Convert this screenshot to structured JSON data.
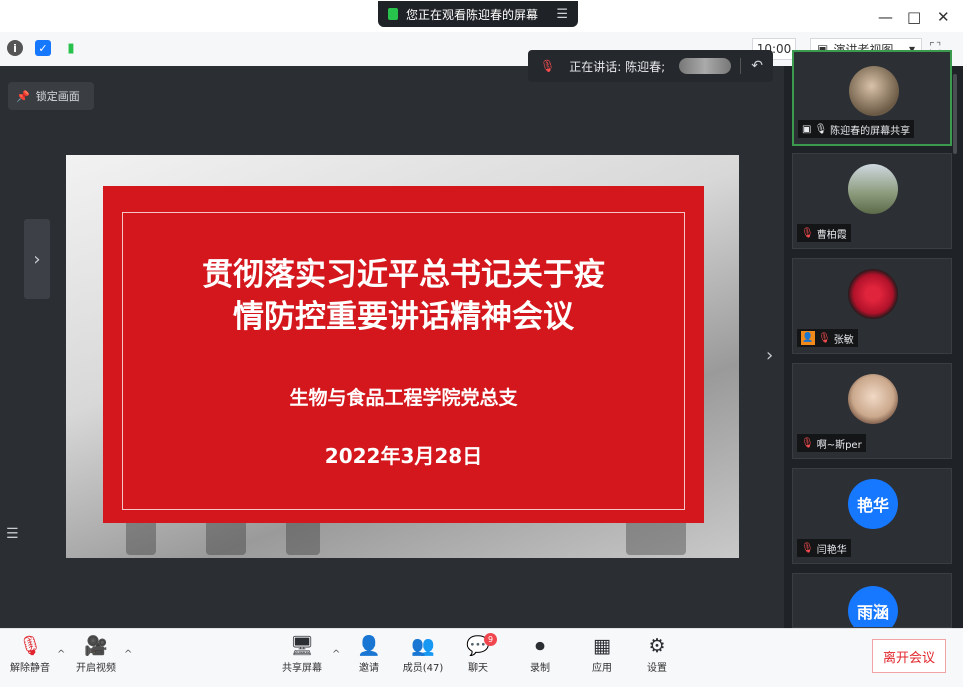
{
  "titlebar": {
    "share_notice": "您正在观看陈迎春的屏幕",
    "menu_icon": "menu-icon"
  },
  "window_controls": {
    "minimize": "—",
    "maximize": "□",
    "close": "✕"
  },
  "toolbar2": {
    "time": "10:00",
    "view_mode": "演讲者视图",
    "view_caret": "▾",
    "fullscreen_icon": "⛶"
  },
  "stage": {
    "lock_label": "锁定画面",
    "speaking_label": "正在讲话: 陈迎春;",
    "slide": {
      "title_line1": "贯彻落实习近平总书记关于疫",
      "title_line2": "情防控重要讲话精神会议",
      "org": "生物与食品工程学院党总支",
      "date": "2022年3月28日"
    }
  },
  "participants": [
    {
      "name": "陈迎春的屏幕共享",
      "avatar_color": "#6b5a45",
      "active": true
    },
    {
      "name": "曹柏霞",
      "avatar_color": "#7a8a6a"
    },
    {
      "name": "张敏",
      "avatar_color": "#b0122a",
      "host_badge": true
    },
    {
      "name": "啊~斯per",
      "avatar_color": "#caa88c"
    },
    {
      "name": "闫艳华",
      "avatar_color": "#1677ff",
      "avatar_text": "艳华"
    },
    {
      "name": "",
      "avatar_color": "#1677ff",
      "avatar_text": "雨涵"
    }
  ],
  "bottombar": {
    "unmute": "解除静音",
    "video": "开启视频",
    "share": "共享屏幕",
    "invite": "邀请",
    "members": "成员(47)",
    "chat": "聊天",
    "chat_badge": "9",
    "record": "录制",
    "apps": "应用",
    "settings": "设置",
    "leave": "离开会议"
  }
}
